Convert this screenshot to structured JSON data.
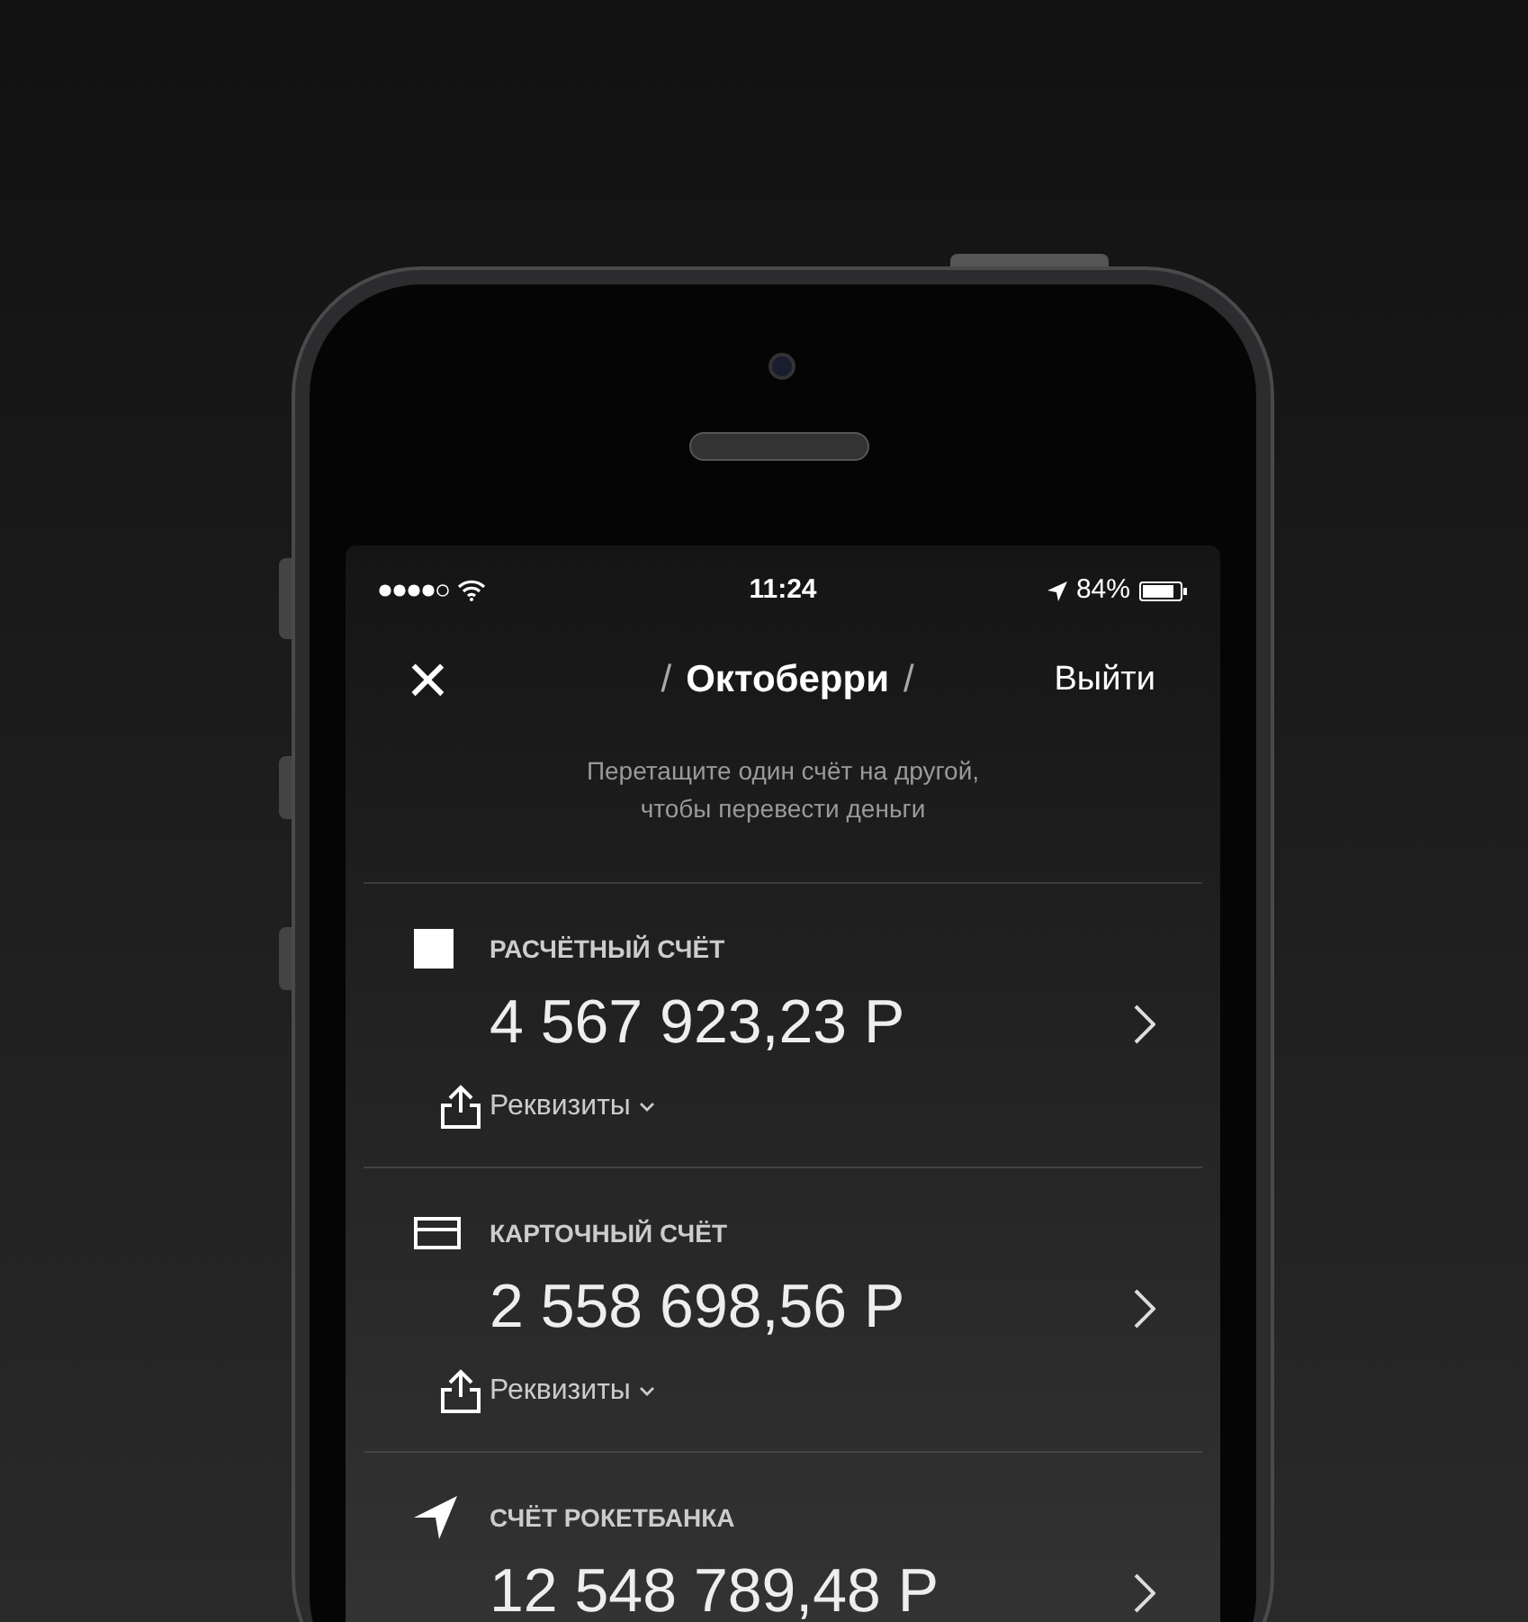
{
  "status_bar": {
    "time": "11:24",
    "battery": "84%"
  },
  "nav": {
    "close": "×",
    "title_prefix": "/",
    "title": "Октоберри",
    "title_suffix": "/",
    "action": "Выйти"
  },
  "hint": "Перетащите один счёт на другой,\nчтобы перевести деньги",
  "accounts": [
    {
      "kind": "square",
      "name": "РАСЧЁТНЫЙ СЧЁТ",
      "amount": "4 567 923,23 Р",
      "details": "Реквизиты"
    },
    {
      "kind": "card",
      "name": "КАРТОЧНЫЙ СЧЁТ",
      "amount": "2 558 698,56 Р",
      "details": "Реквизиты"
    },
    {
      "kind": "rocket",
      "name": "СЧЁТ РОКЕТБАНКА",
      "amount": "12 548 789,48 Р"
    }
  ]
}
